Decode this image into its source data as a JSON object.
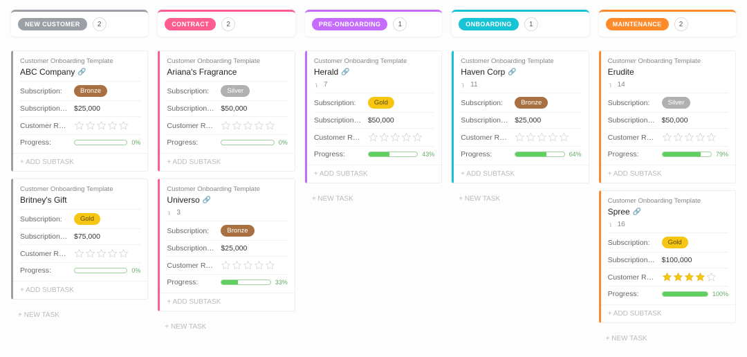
{
  "labels": {
    "template": "Customer Onboarding Template",
    "subscription": "Subscription:",
    "subscription_amount": "Subscription…",
    "customer_rating": "Customer R…",
    "progress": "Progress:",
    "add_subtask": "+ ADD SUBTASK",
    "new_task": "+ NEW TASK",
    "attach": "📎"
  },
  "colors": {
    "new_customer": "#9aa0a6",
    "contract": "#ff5d8f",
    "pre_onboarding": "#c56cff",
    "onboarding": "#19c3d6",
    "maintenance": "#ff8a2a"
  },
  "columns": [
    {
      "id": "new_customer",
      "title": "NEW CUSTOMER",
      "count": "2",
      "cards": [
        {
          "title": "ABC Company",
          "attach": true,
          "subtasks": "",
          "tier": "Bronze",
          "amount": "$25,000",
          "rating": 0,
          "progress": 0
        },
        {
          "title": "Britney's Gift",
          "attach": false,
          "subtasks": "",
          "tier": "Gold",
          "amount": "$75,000",
          "rating": 0,
          "progress": 0
        }
      ]
    },
    {
      "id": "contract",
      "title": "CONTRACT",
      "count": "2",
      "cards": [
        {
          "title": "Ariana's Fragrance",
          "attach": false,
          "subtasks": "",
          "tier": "Silver",
          "amount": "$50,000",
          "rating": 0,
          "progress": 0
        },
        {
          "title": "Universo",
          "attach": true,
          "subtasks": "3",
          "tier": "Bronze",
          "amount": "$25,000",
          "rating": 0,
          "progress": 33
        }
      ]
    },
    {
      "id": "pre_onboarding",
      "title": "PRE-ONBOARDING",
      "count": "1",
      "cards": [
        {
          "title": "Herald",
          "attach": true,
          "subtasks": "7",
          "tier": "Gold",
          "amount": "$50,000",
          "rating": 0,
          "progress": 43
        }
      ]
    },
    {
      "id": "onboarding",
      "title": "ONBOARDING",
      "count": "1",
      "cards": [
        {
          "title": "Haven Corp",
          "attach": true,
          "subtasks": "11",
          "tier": "Bronze",
          "amount": "$25,000",
          "rating": 0,
          "progress": 64
        }
      ]
    },
    {
      "id": "maintenance",
      "title": "MAINTENANCE",
      "count": "2",
      "cards": [
        {
          "title": "Erudite",
          "attach": false,
          "subtasks": "14",
          "tier": "Silver",
          "amount": "$50,000",
          "rating": 0,
          "progress": 79
        },
        {
          "title": "Spree",
          "attach": true,
          "subtasks": "16",
          "tier": "Gold",
          "amount": "$100,000",
          "rating": 4,
          "progress": 100
        }
      ]
    }
  ]
}
